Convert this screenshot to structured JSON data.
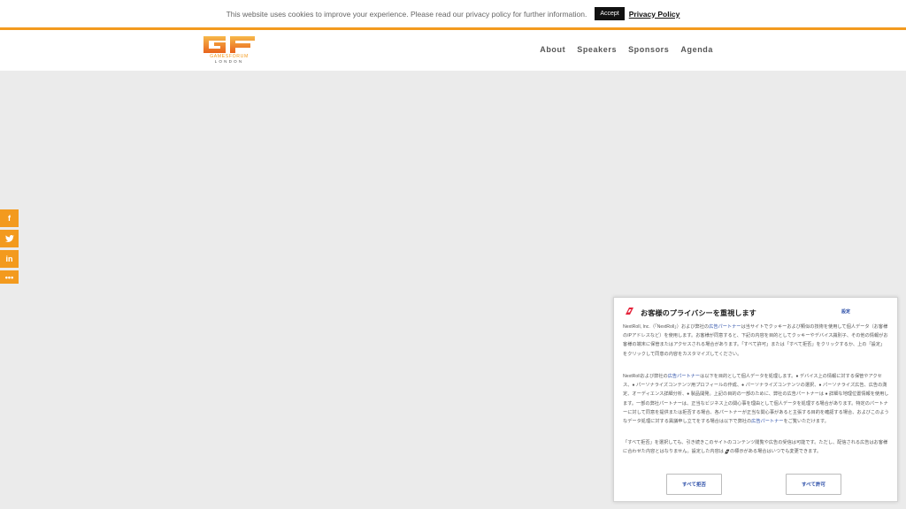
{
  "cookie_bar": {
    "text": "This website uses cookies to improve your experience. Please read our privacy policy for further information.",
    "accept_label": "Accept",
    "policy_link": "Privacy Policy"
  },
  "header": {
    "logo_line1": "GAMESFORUM",
    "logo_line2": "LONDON",
    "nav": [
      "About",
      "Speakers",
      "Sponsors",
      "Agenda"
    ]
  },
  "share": {
    "facebook": "f",
    "twitter": "t",
    "linkedin": "in",
    "more": "•••"
  },
  "privacy": {
    "title": "お客様のプライバシーを重視します",
    "settings_label": "設定",
    "p1_a": "NextRoll, Inc.（「NextRoll」）および弊社の",
    "p1_link": "広告パートナー",
    "p1_b": "は当サイトでクッキーおよび類似の技術を使用して個人データ（お客様のIPアドレスなど）を使用します。お客様が同意すると、下記の内容を目的としてクッキーやデバイス識別子、その他の情報がお客様の端末に保管またはアクセスされる場合があります。「すべて許可」または「すべて拒否」をクリックするか、上の「設定」をクリックして同意の内容をカスタマイズしてください。",
    "p2_a": "NextRollおよび弊社の",
    "p2_link": "広告パートナー",
    "p2_b": "は以下を目的として個人データを処理します。● デバイス上の情報に対する保管やアクセス、● パーソナライズコンテンツ用プロフィールの作成、● パーソナライズコンテンツの選択、● パーソナライズ広告、広告の測定、オーディエンス詳細分析、● 製品開発。上記の目的の一部のために、弊社の広告パートナーは ● 詳細な地理位置情報を使用します。一部の弊社パートナーは、正当なビジネス上の関心事を理由として個人データを処理する場合があります。特定のパートナーに対して同意を提供または拒否する場合、各パートナーが正当な関心事があると主張する目的を確認する場合、およびこのようなデータ処理に対する異議申し立てをする場合は以下で弊社の",
    "p2_link2": "広告パートナー",
    "p2_c": "をご覧いただけます。",
    "p3_a": "「すべて拒否」を選択しても、引き続きこのサイトのコンテンツ閲覧や広告の受信は可能です。ただし、配信される広告はお客様に合わせた内容とはなりません。設定した内容は",
    "p3_b": "の標示がある場合はいつでも変更できます。",
    "reject_label": "すべて拒否",
    "accept_label": "すべて許可"
  },
  "colors": {
    "accent": "#f39a1e",
    "link_blue": "#2b4ea8",
    "background": "#ebebeb"
  }
}
